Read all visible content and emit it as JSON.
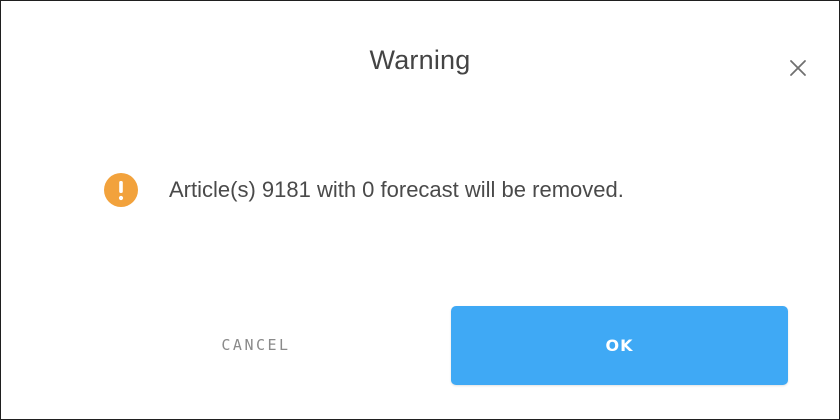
{
  "dialog": {
    "title": "Warning",
    "close_icon": "close-icon",
    "message_icon": "exclamation-icon",
    "message": "Article(s) 9181 with 0 forecast will be removed.",
    "cancel_label": "CANCEL",
    "ok_label": "OK"
  },
  "colors": {
    "accent": "#3fa9f5",
    "warning": "#f2a23c",
    "text": "#444444",
    "muted": "#8a8a8a"
  }
}
